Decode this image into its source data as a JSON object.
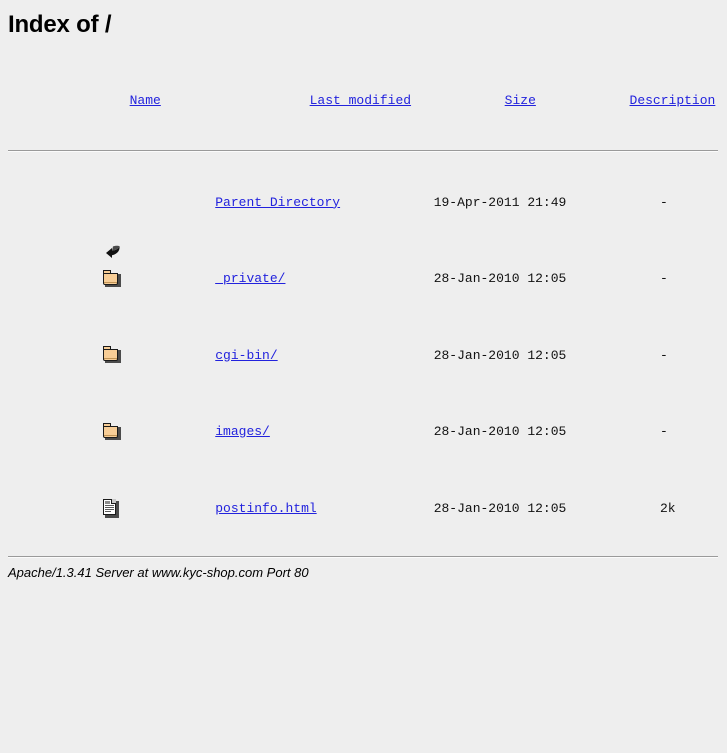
{
  "page": {
    "title": "Index of /"
  },
  "table": {
    "headers": {
      "icon": "",
      "name": "Name",
      "last_modified": "Last modified",
      "size": "Size",
      "description": "Description"
    },
    "rows": [
      {
        "icon": "back-arrow-icon",
        "name": "Parent Directory",
        "last_modified": "19-Apr-2011 21:49",
        "size": "-",
        "description": ""
      },
      {
        "icon": "folder-icon",
        "name": "_private/",
        "last_modified": "28-Jan-2010 12:05",
        "size": "-",
        "description": ""
      },
      {
        "icon": "folder-icon",
        "name": "cgi-bin/",
        "last_modified": "28-Jan-2010 12:05",
        "size": "-",
        "description": ""
      },
      {
        "icon": "folder-icon",
        "name": "images/",
        "last_modified": "28-Jan-2010 12:05",
        "size": "-",
        "description": ""
      },
      {
        "icon": "document-icon",
        "name": "postinfo.html",
        "last_modified": "28-Jan-2010 12:05",
        "size": "2k",
        "description": ""
      }
    ]
  },
  "footer": {
    "address": "Apache/1.3.41 Server at www.kyc-shop.com Port 80"
  },
  "colors": {
    "background": "#eeeeee",
    "link": "#2222dd",
    "text": "#000000",
    "rule": "#9a9a9a",
    "folder_fill": "#f7cd96"
  }
}
